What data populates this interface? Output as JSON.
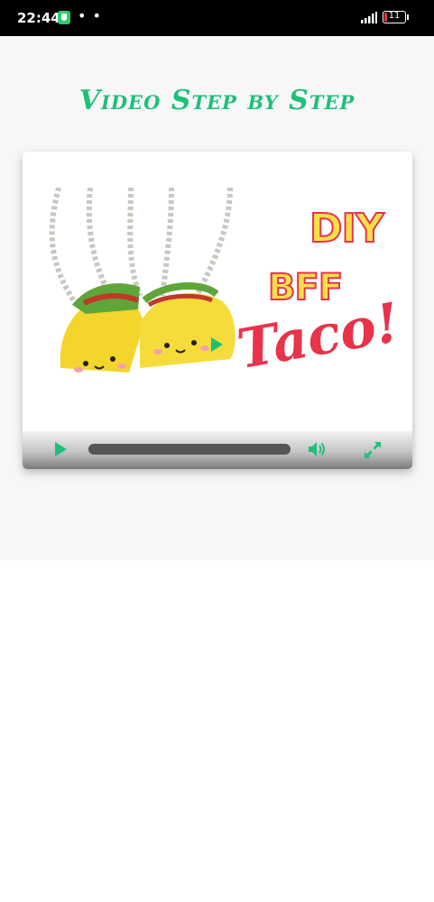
{
  "status_bar": {
    "time": "22:44",
    "dots": "• •",
    "battery_level": "11"
  },
  "page": {
    "title": "Video Step by Step"
  },
  "video": {
    "thumbnail_text": {
      "line1": "DIY",
      "line2": "BFF",
      "line3": "Taco!"
    },
    "progress_fraction": 0,
    "controls": [
      "play-icon",
      "progress-bar",
      "volume-icon",
      "fullscreen-icon"
    ]
  },
  "colors": {
    "accent": "#1ec078",
    "title_green": "#1ec078",
    "thumb_yellow": "#f6e04a",
    "thumb_red": "#e8334a"
  }
}
